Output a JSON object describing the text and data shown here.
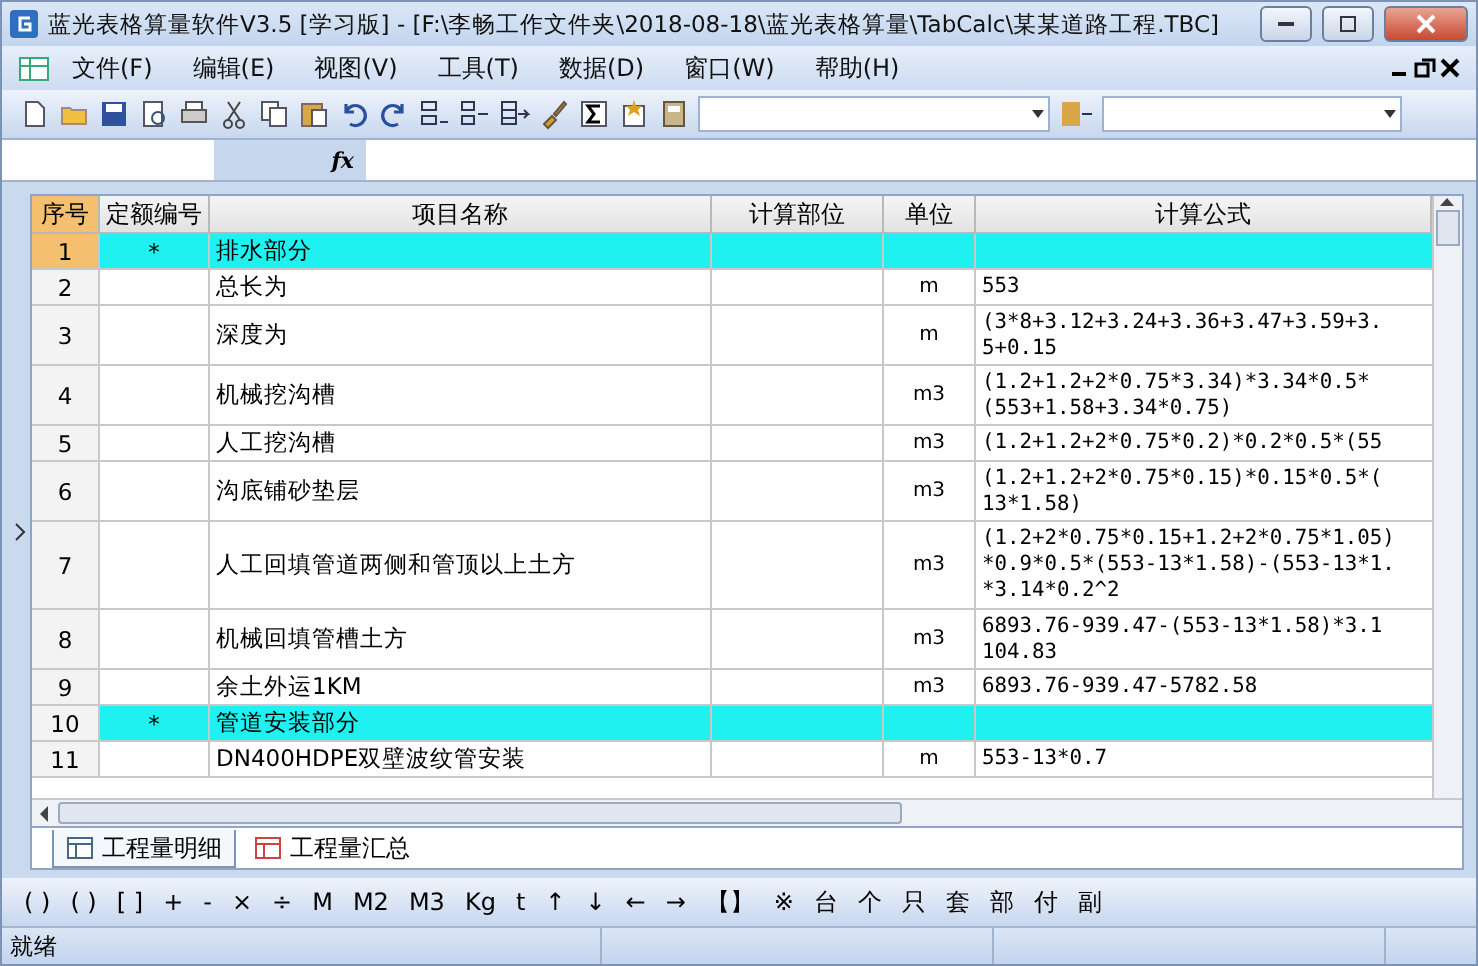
{
  "window": {
    "title": "蓝光表格算量软件V3.5 [学习版] - [F:\\李畅工作文件夹\\2018-08-18\\蓝光表格算量\\TabCalc\\某某道路工程.TBC]"
  },
  "menu": [
    "文件(F)",
    "编辑(E)",
    "视图(V)",
    "工具(T)",
    "数据(D)",
    "窗口(W)",
    "帮助(H)"
  ],
  "formula_bar": {
    "label": "fx"
  },
  "table": {
    "columns": [
      "序号",
      "定额编号",
      "项目名称",
      "计算部位",
      "单位",
      "计算公式"
    ],
    "rows": [
      {
        "number": "1",
        "code": "*",
        "name": "排水部分",
        "formula": [],
        "kind": "section",
        "selected": true
      },
      {
        "number": "2",
        "name": "总长为",
        "unit": "m",
        "formula": [
          "553"
        ],
        "kind": "item",
        "selected": false
      },
      {
        "number": "3",
        "name": "深度为",
        "unit": "m",
        "formula": [
          "(3*8+3.12+3.24+3.36+3.47+3.59+3.",
          "5+0.15"
        ],
        "kind": "item",
        "selected": false
      },
      {
        "number": "4",
        "name": "机械挖沟槽",
        "unit": "m3",
        "formula": [
          "(1.2+1.2+2*0.75*3.34)*3.34*0.5*",
          "(553+1.58+3.34*0.75)"
        ],
        "kind": "item",
        "selected": false
      },
      {
        "number": "5",
        "name": "人工挖沟槽",
        "unit": "m3",
        "formula": [
          "(1.2+1.2+2*0.75*0.2)*0.2*0.5*(55"
        ],
        "kind": "item",
        "selected": false
      },
      {
        "number": "6",
        "name": "沟底铺砂垫层",
        "unit": "m3",
        "formula": [
          "(1.2+1.2+2*0.75*0.15)*0.15*0.5*(",
          "13*1.58)"
        ],
        "kind": "item",
        "selected": false
      },
      {
        "number": "7",
        "name": "人工回填管道两侧和管顶以上土方",
        "unit": "m3",
        "formula": [
          "(1.2+2*0.75*0.15+1.2+2*0.75*1.05)",
          "*0.9*0.5*(553-13*1.58)-(553-13*1.",
          "*3.14*0.2^2"
        ],
        "kind": "item",
        "selected": false
      },
      {
        "number": "8",
        "name": "机械回填管槽土方",
        "unit": "m3",
        "formula": [
          "6893.76-939.47-(553-13*1.58)*3.1",
          "104.83"
        ],
        "kind": "item",
        "selected": false
      },
      {
        "number": "9",
        "name": "余土外运1KM",
        "unit": "m3",
        "formula": [
          "6893.76-939.47-5782.58"
        ],
        "kind": "item",
        "selected": false
      },
      {
        "number": "10",
        "code": "*",
        "name": "管道安装部分",
        "formula": [],
        "kind": "section",
        "selected": false
      },
      {
        "number": "11",
        "name": "DN400HDPE双壁波纹管安装",
        "unit": "m",
        "formula": [
          "553-13*0.7"
        ],
        "kind": "item",
        "selected": false
      }
    ]
  },
  "sheet_tabs": [
    {
      "label": "工程量明细",
      "selected": true
    },
    {
      "label": "工程量汇总",
      "selected": false
    }
  ],
  "symbol_bar": [
    "( )",
    "( )",
    "[ ]",
    "+",
    "-",
    "×",
    "÷",
    "M",
    "M2",
    "M3",
    "Kg",
    "t",
    "↑",
    "↓",
    "←",
    "→",
    "【】",
    "※",
    "台",
    "个",
    "只",
    "套",
    "部",
    "付",
    "副"
  ],
  "status_bar": {
    "text": "就绪"
  }
}
